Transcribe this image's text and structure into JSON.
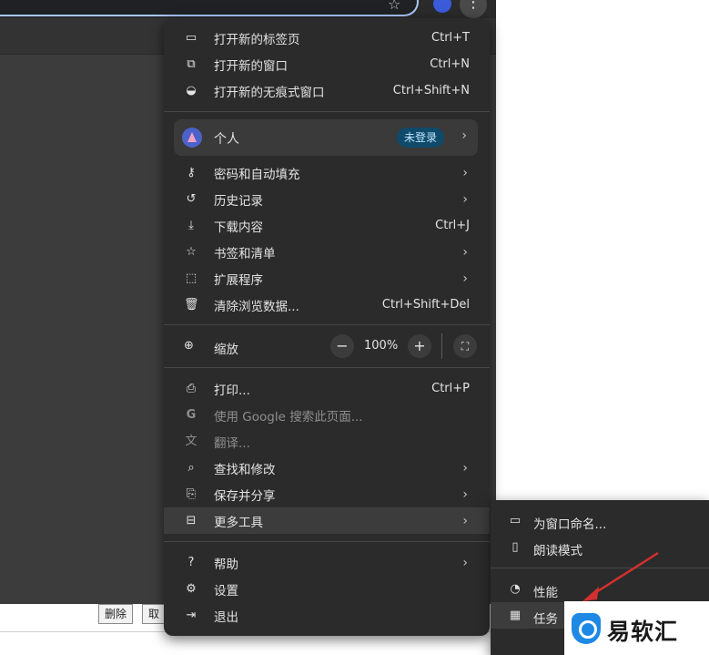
{
  "colors": {
    "menu_bg": "#2b2b2b",
    "highlight": "#3c3c3c",
    "badge_bg": "#0f4a6b",
    "badge_text": "#c2e7ff",
    "annotation_arrow": "#d32f2f",
    "watermark_icon": "#1e88e5"
  },
  "background": {
    "buttons": [
      "删除",
      "取"
    ]
  },
  "menu": {
    "section1": [
      {
        "icon": "new-tab-icon",
        "label": "打开新的标签页",
        "shortcut": "Ctrl+T"
      },
      {
        "icon": "new-window-icon",
        "label": "打开新的窗口",
        "shortcut": "Ctrl+N"
      },
      {
        "icon": "incognito-icon",
        "label": "打开新的无痕式窗口",
        "shortcut": "Ctrl+Shift+N"
      }
    ],
    "profile": {
      "name": "个人",
      "badge": "未登录"
    },
    "section2": [
      {
        "icon": "key-icon",
        "label": "密码和自动填充"
      },
      {
        "icon": "history-icon",
        "label": "历史记录"
      },
      {
        "icon": "download-icon",
        "label": "下载内容",
        "shortcut": "Ctrl+J"
      },
      {
        "icon": "star-icon",
        "label": "书签和清单"
      },
      {
        "icon": "extension-icon",
        "label": "扩展程序"
      },
      {
        "icon": "trash-icon",
        "label": "清除浏览数据...",
        "shortcut": "Ctrl+Shift+Del"
      }
    ],
    "zoom": {
      "label": "缩放",
      "value": "100%",
      "minus": "−",
      "plus": "+"
    },
    "section3": [
      {
        "icon": "print-icon",
        "label": "打印...",
        "shortcut": "Ctrl+P"
      },
      {
        "icon": "google-icon",
        "label": "使用 Google 搜索此页面..."
      },
      {
        "icon": "translate-icon",
        "label": "翻译..."
      },
      {
        "icon": "find-icon",
        "label": "查找和修改"
      },
      {
        "icon": "save-share-icon",
        "label": "保存并分享"
      },
      {
        "icon": "toolbox-icon",
        "label": "更多工具"
      }
    ],
    "section4": [
      {
        "icon": "help-icon",
        "label": "帮助"
      },
      {
        "icon": "settings-icon",
        "label": "设置"
      },
      {
        "icon": "exit-icon",
        "label": "退出"
      }
    ]
  },
  "submenu": {
    "items": [
      {
        "icon": "window-name-icon",
        "label": "为窗口命名..."
      },
      {
        "icon": "reading-mode-icon",
        "label": "朗读模式"
      },
      {
        "icon": "performance-icon",
        "label": "性能"
      },
      {
        "icon": "task-manager-icon",
        "label": "任务"
      }
    ]
  },
  "watermark": {
    "text": "易软汇"
  }
}
